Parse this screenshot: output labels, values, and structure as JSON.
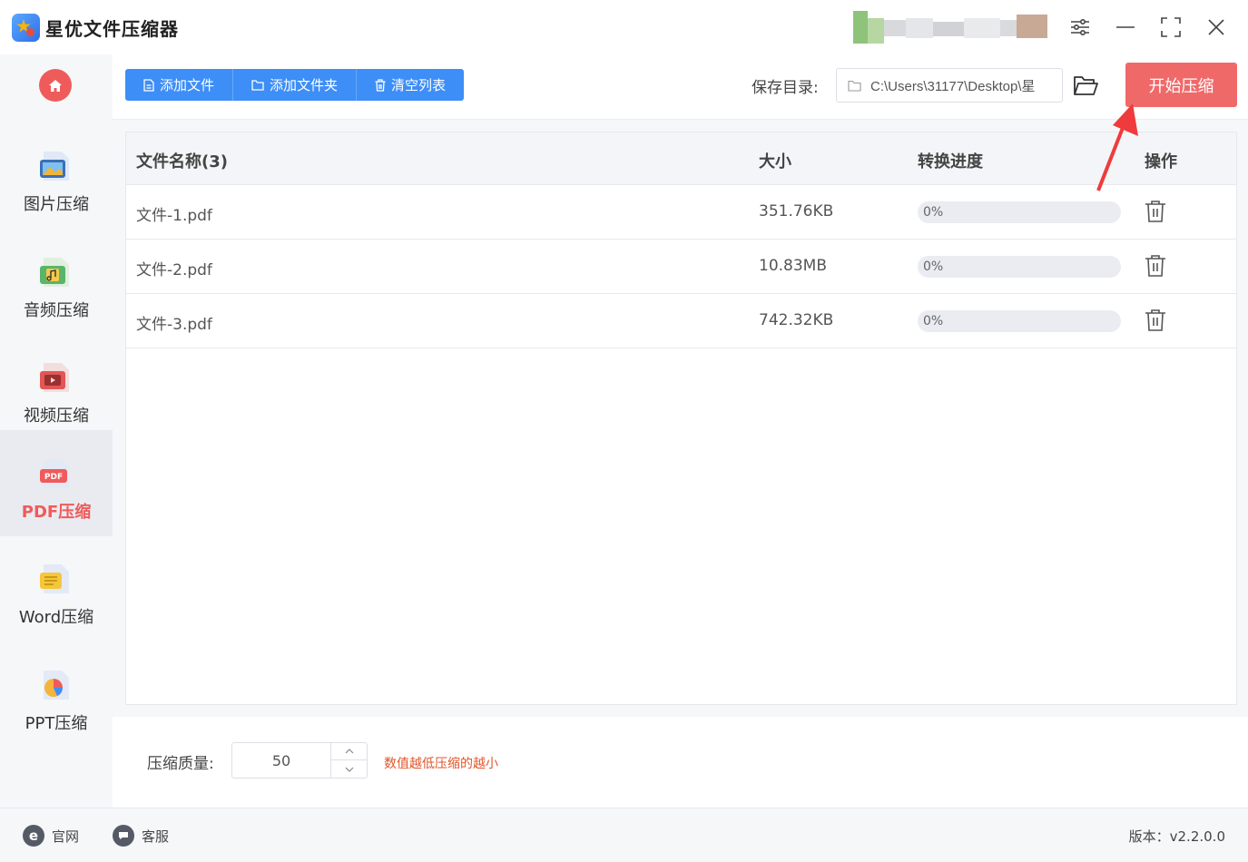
{
  "app": {
    "title": "星优文件压缩器"
  },
  "sidebar": {
    "items": [
      {
        "label": "图片压缩",
        "icon": "image-file-icon"
      },
      {
        "label": "音频压缩",
        "icon": "audio-file-icon"
      },
      {
        "label": "视频压缩",
        "icon": "video-file-icon"
      },
      {
        "label": "PDF压缩",
        "icon": "pdf-file-icon",
        "active": true
      },
      {
        "label": "Word压缩",
        "icon": "word-file-icon"
      },
      {
        "label": "PPT压缩",
        "icon": "ppt-file-icon"
      }
    ]
  },
  "toolbar": {
    "add_file": "添加文件",
    "add_folder": "添加文件夹",
    "clear_list": "清空列表",
    "save_dir_label": "保存目录:",
    "save_dir_value": "C:\\Users\\31177\\Desktop\\星",
    "start_button": "开始压缩"
  },
  "table": {
    "headers": {
      "name": "文件名称(3)",
      "size": "大小",
      "progress": "转换进度",
      "action": "操作"
    },
    "rows": [
      {
        "name": "文件-1.pdf",
        "size": "351.76KB",
        "progress_text": "0%",
        "progress_value": 0
      },
      {
        "name": "文件-2.pdf",
        "size": "10.83MB",
        "progress_text": "0%",
        "progress_value": 0
      },
      {
        "name": "文件-3.pdf",
        "size": "742.32KB",
        "progress_text": "0%",
        "progress_value": 0
      }
    ]
  },
  "quality": {
    "label": "压缩质量:",
    "value": "50",
    "hint": "数值越低压缩的越小"
  },
  "footer": {
    "website": "官网",
    "support": "客服",
    "version": "版本：v2.2.0.0"
  },
  "colors": {
    "accent_blue": "#3d8ef7",
    "accent_red": "#f06969",
    "hint_orange": "#e0562b"
  }
}
